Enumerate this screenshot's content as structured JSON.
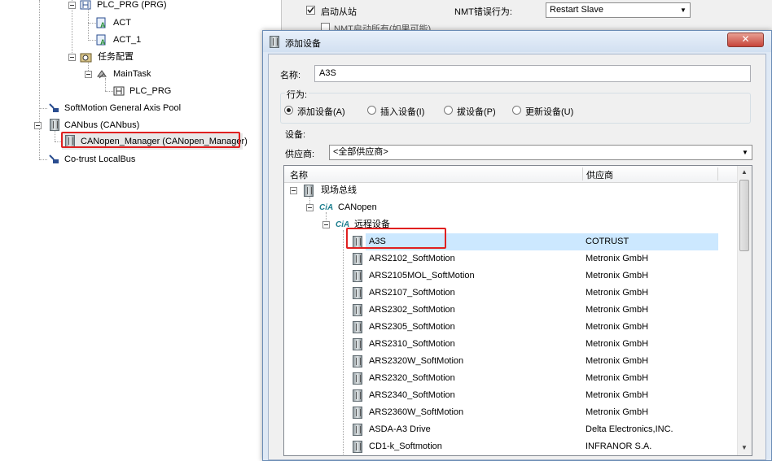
{
  "tree": {
    "items": [
      {
        "label": "PLC_PRG (PRG)",
        "icon": "program-icon"
      },
      {
        "label": "ACT",
        "icon": "action-icon"
      },
      {
        "label": "ACT_1",
        "icon": "action-icon"
      },
      {
        "label": "任务配置",
        "icon": "task-config-icon"
      },
      {
        "label": "MainTask",
        "icon": "task-icon"
      },
      {
        "label": "PLC_PRG",
        "icon": "program-call-icon"
      },
      {
        "label": "SoftMotion General Axis Pool",
        "icon": "axis-pool-icon"
      },
      {
        "label": "CANbus (CANbus)",
        "icon": "device-icon"
      },
      {
        "label": "CANopen_Manager (CANopen_Manager)",
        "icon": "device-icon"
      },
      {
        "label": "Co-trust LocalBus",
        "icon": "localbus-icon"
      }
    ]
  },
  "editor": {
    "start_slave_label": "启动从站",
    "nmt_error_label": "NMT错误行为:",
    "nmt_error_value": "Restart Slave",
    "nmt_all_label": "NMT启动所有(如果可能)"
  },
  "dialog": {
    "title": "添加设备",
    "close_symbol": "✕",
    "name_label": "名称:",
    "name_value": "A3S",
    "action_group_label": "行为:",
    "actions": [
      {
        "label": "添加设备(A)",
        "selected": true
      },
      {
        "label": "插入设备(I)",
        "selected": false
      },
      {
        "label": "拔设备(P)",
        "selected": false
      },
      {
        "label": "更新设备(U)",
        "selected": false
      }
    ],
    "device_group_label": "设备:",
    "vendor_label": "供应商:",
    "vendor_value": "<全部供应商>",
    "columns": {
      "name": "名称",
      "vendor": "供应商"
    },
    "categories": [
      "现场总线",
      "CANopen",
      "远程设备"
    ],
    "devices": [
      {
        "name": "A3S",
        "vendor": "COTRUST"
      },
      {
        "name": "ARS2102_SoftMotion",
        "vendor": "Metronix GmbH"
      },
      {
        "name": "ARS2105MOL_SoftMotion",
        "vendor": "Metronix GmbH"
      },
      {
        "name": "ARS2107_SoftMotion",
        "vendor": "Metronix GmbH"
      },
      {
        "name": "ARS2302_SoftMotion",
        "vendor": "Metronix GmbH"
      },
      {
        "name": "ARS2305_SoftMotion",
        "vendor": "Metronix GmbH"
      },
      {
        "name": "ARS2310_SoftMotion",
        "vendor": "Metronix GmbH"
      },
      {
        "name": "ARS2320W_SoftMotion",
        "vendor": "Metronix GmbH"
      },
      {
        "name": "ARS2320_SoftMotion",
        "vendor": "Metronix GmbH"
      },
      {
        "name": "ARS2340_SoftMotion",
        "vendor": "Metronix GmbH"
      },
      {
        "name": "ARS2360W_SoftMotion",
        "vendor": "Metronix GmbH"
      },
      {
        "name": "ASDA-A3 Drive",
        "vendor": "Delta Electronics,INC."
      },
      {
        "name": "CD1-k_Softmotion",
        "vendor": "INFRANOR S.A."
      }
    ],
    "cia_label": "CiA"
  },
  "colors": {
    "highlight_red": "#e02020",
    "selection": "#cce8ff",
    "dialog_frame": "#6c8db6"
  }
}
